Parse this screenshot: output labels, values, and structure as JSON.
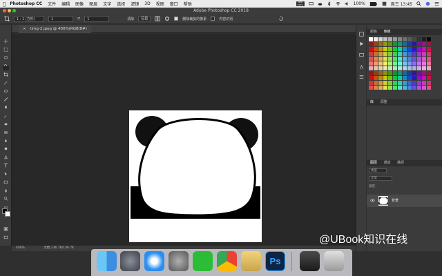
{
  "menubar": {
    "app_name": "Photoshop CC",
    "items": [
      "文件",
      "编辑",
      "图像",
      "图层",
      "文字",
      "选择",
      "滤镜",
      "3D",
      "视图",
      "窗口",
      "帮助"
    ],
    "indicator": "MEM\n100%",
    "battery": "100%",
    "clock": "周三 13:45"
  },
  "window": {
    "title": "Adobe Photoshop CC 2018"
  },
  "options_bar": {
    "ratio": "1 : 1 (方形)",
    "width": "1",
    "height": "1",
    "clear": "清除",
    "straighten": "拉直",
    "delete_cropped": "删除裁剪的像素",
    "content_aware": "内容识别"
  },
  "document": {
    "tab_title": "timg-2.jpeg @ 400%(RGB/8#)"
  },
  "status_bar": {
    "zoom": "400%",
    "doc_info": "文档:136.7K/136.7K"
  },
  "panels": {
    "swatches_tabs": [
      "颜色",
      "色板"
    ],
    "properties_tabs": [
      "库",
      "调整"
    ],
    "layers_tabs": [
      "图层",
      "通道",
      "路径"
    ],
    "layers_kind": "类型",
    "layers_blend": "正常",
    "layers_lock": "锁定：",
    "layer_name": "背景"
  },
  "watermark": "@UBook知识在线",
  "colors": {
    "ps_blue": "#1b3e73",
    "ps_text": "#31a8ff"
  }
}
